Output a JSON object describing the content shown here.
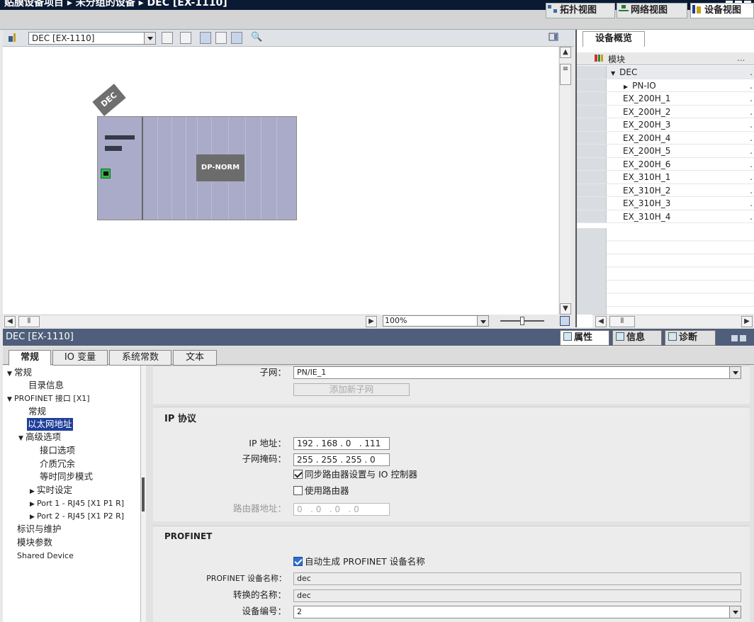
{
  "title_bar": {
    "breadcrumb": "贴膜设备项目 ▸ 未分组的设备 ▸ DEC [EX-1110]"
  },
  "view_tabs": [
    {
      "label": "拓扑视图"
    },
    {
      "label": "网络视图"
    },
    {
      "label": "设备视图"
    }
  ],
  "toolbar": {
    "device_select": "DEC [EX-1110]"
  },
  "canvas": {
    "device_label": "DEC",
    "module_label": "DP-NORM",
    "zoom": "100%"
  },
  "overview": {
    "tab": "设备概览",
    "column_module": "模块",
    "rows": [
      {
        "name": "DEC",
        "level": 1,
        "caret": "▼",
        "selected": true
      },
      {
        "name": "PN-IO",
        "level": 2,
        "caret": "▶"
      },
      {
        "name": "EX_200H_1",
        "level": 0
      },
      {
        "name": "EX_200H_2",
        "level": 0
      },
      {
        "name": "EX_200H_3",
        "level": 0
      },
      {
        "name": "EX_200H_4",
        "level": 0
      },
      {
        "name": "EX_200H_5",
        "level": 0
      },
      {
        "name": "EX_200H_6",
        "level": 0
      },
      {
        "name": "EX_310H_1",
        "level": 0
      },
      {
        "name": "EX_310H_2",
        "level": 0
      },
      {
        "name": "EX_310H_3",
        "level": 0
      },
      {
        "name": "EX_310H_4",
        "level": 0
      }
    ]
  },
  "properties": {
    "header": "DEC [EX-1110]",
    "tabs": [
      {
        "label": "属性"
      },
      {
        "label": "信息"
      },
      {
        "label": "诊断"
      }
    ],
    "subtabs": [
      "常规",
      "IO 变量",
      "系统常数",
      "文本"
    ]
  },
  "nav": {
    "items": [
      {
        "label": "常规",
        "caret": "▼"
      },
      {
        "label": "目录信息"
      },
      {
        "label": "PROFINET 接口 [X1]",
        "caret": "▼"
      },
      {
        "label": "常规"
      },
      {
        "label": "以太网地址",
        "selected": true
      },
      {
        "label": "高级选项",
        "caret": "▼"
      },
      {
        "label": "接口选项"
      },
      {
        "label": "介质冗余"
      },
      {
        "label": "等时同步模式"
      },
      {
        "label": "实时设定",
        "caret": "▶"
      },
      {
        "label": "Port 1 - RJ45 [X1 P1 R]",
        "caret": "▶"
      },
      {
        "label": "Port 2 - RJ45 [X1 P2 R]",
        "caret": "▶"
      },
      {
        "label": "标识与维护"
      },
      {
        "label": "模块参数"
      },
      {
        "label": "Shared Device"
      }
    ]
  },
  "content": {
    "subnet_label": "子网：",
    "subnet_value": "PN/IE_1",
    "add_subnet_button": "添加新子网",
    "ip_section_title": "IP 协议",
    "ip_label": "IP 地址：",
    "ip_value": "192 . 168 . 0   . 111",
    "mask_label": "子网掩码：",
    "mask_value": "255 . 255 . 255 . 0",
    "sync_router_label": "同步路由器设置与 IO 控制器",
    "sync_router_checked": true,
    "use_router_label": "使用路由器",
    "use_router_checked": false,
    "router_addr_label": "路由器地址：",
    "router_addr_value": "0   . 0   . 0   . 0",
    "profinet_section_title": "PROFINET",
    "auto_name_label": "自动生成 PROFINET 设备名称",
    "auto_name_checked": true,
    "device_name_label": "PROFINET 设备名称：",
    "device_name_value": "dec",
    "converted_name_label": "转换的名称：",
    "converted_name_value": "dec",
    "device_number_label": "设备编号：",
    "device_number_value": "2"
  }
}
